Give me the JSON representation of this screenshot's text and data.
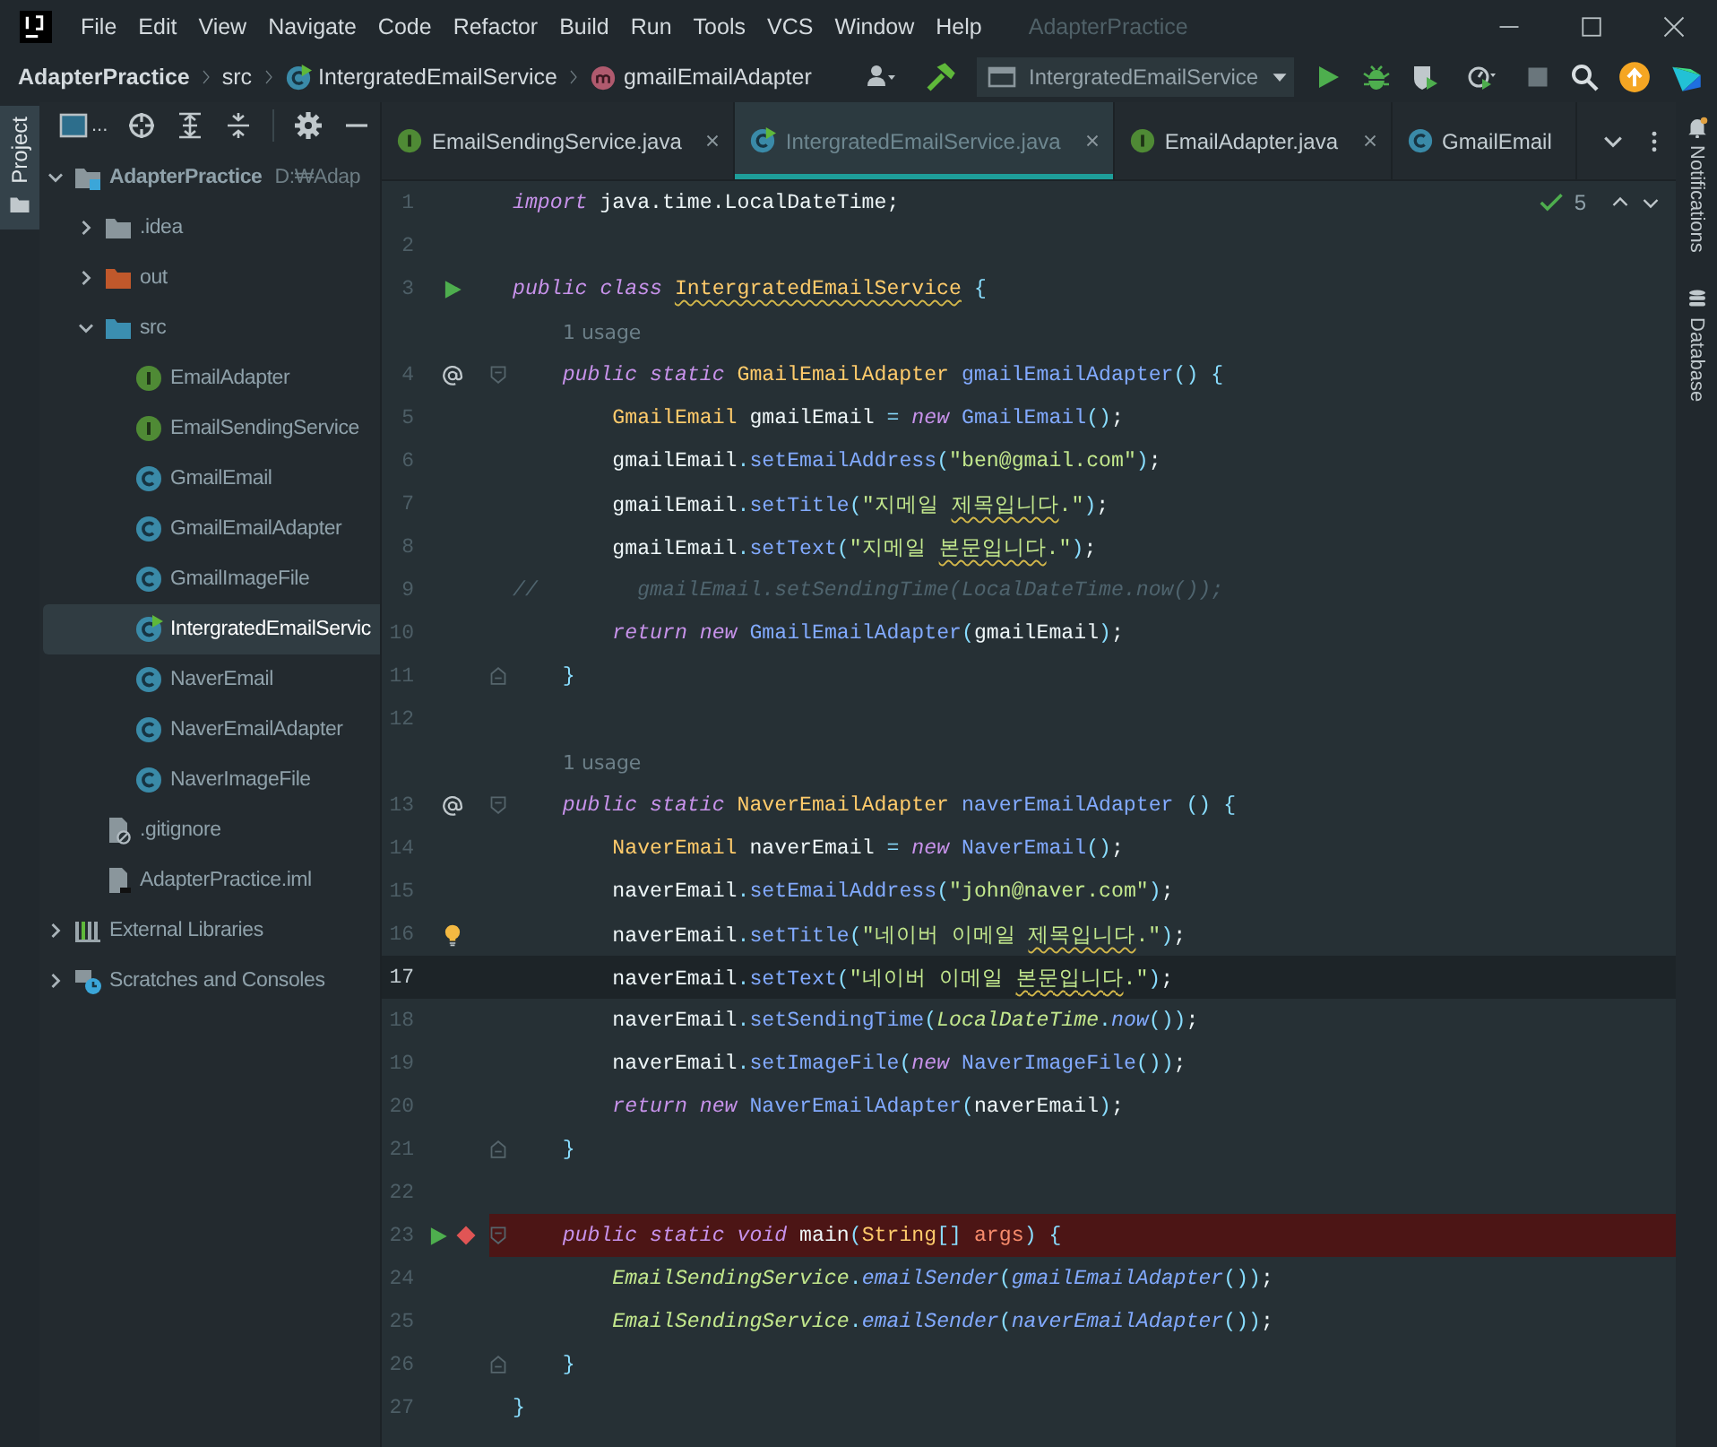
{
  "window": {
    "title": "AdapterPractice"
  },
  "menu": [
    "File",
    "Edit",
    "View",
    "Navigate",
    "Code",
    "Refactor",
    "Build",
    "Run",
    "Tools",
    "VCS",
    "Window",
    "Help"
  ],
  "breadcrumbs": [
    {
      "label": "AdapterPractice",
      "kind": "project"
    },
    {
      "label": "src",
      "kind": "folder"
    },
    {
      "label": "IntergratedEmailService",
      "kind": "main-class"
    },
    {
      "label": "gmailEmailAdapter",
      "kind": "method"
    }
  ],
  "toolbar": {
    "run_config": "IntergratedEmailService"
  },
  "project_panel": {
    "tab": "Project",
    "view_selector": "...",
    "tree": [
      {
        "label": "AdapterPractice",
        "path": "D:₩Adap",
        "kind": "module",
        "expanded": true,
        "selected": false,
        "children": [
          {
            "label": ".idea",
            "kind": "folder",
            "expanded": false,
            "selected": false
          },
          {
            "label": "out",
            "kind": "excluded-folder",
            "expanded": false,
            "selected": false
          },
          {
            "label": "src",
            "kind": "source-folder",
            "expanded": true,
            "selected": false,
            "children": [
              {
                "label": "EmailAdapter",
                "kind": "interface",
                "selected": false
              },
              {
                "label": "EmailSendingService",
                "kind": "interface",
                "selected": false
              },
              {
                "label": "GmailEmail",
                "kind": "class",
                "selected": false
              },
              {
                "label": "GmailEmailAdapter",
                "kind": "class",
                "selected": false
              },
              {
                "label": "GmailImageFile",
                "kind": "class",
                "selected": false
              },
              {
                "label": "IntergratedEmailServic",
                "kind": "main-class",
                "selected": true
              },
              {
                "label": "NaverEmail",
                "kind": "class",
                "selected": false
              },
              {
                "label": "NaverEmailAdapter",
                "kind": "class",
                "selected": false
              },
              {
                "label": "NaverImageFile",
                "kind": "class",
                "selected": false
              }
            ]
          },
          {
            "label": ".gitignore",
            "kind": "ignore-file",
            "selected": false
          },
          {
            "label": "AdapterPractice.iml",
            "kind": "module-file",
            "selected": false
          }
        ]
      },
      {
        "label": "External Libraries",
        "kind": "libraries",
        "expanded": false,
        "selected": false
      },
      {
        "label": "Scratches and Consoles",
        "kind": "scratches",
        "expanded": false,
        "selected": false
      }
    ]
  },
  "tabs": [
    {
      "label": "EmailSendingService.java",
      "kind": "interface",
      "selected": false,
      "closable": true
    },
    {
      "label": "IntergratedEmailService.java",
      "kind": "main-class",
      "selected": true,
      "closable": true
    },
    {
      "label": "EmailAdapter.java",
      "kind": "interface",
      "selected": false,
      "closable": true
    },
    {
      "label": "GmailEmail",
      "kind": "class",
      "selected": false,
      "closable": false
    }
  ],
  "inspections": {
    "count": "5"
  },
  "editor": {
    "lines": [
      {
        "number": "1",
        "current": false,
        "breakpoint": false,
        "tokens": [
          {
            "kind": "kw",
            "text": "import "
          },
          {
            "kind": "id",
            "text": "java.time.LocalDateTime;"
          }
        ]
      },
      {
        "number": "2",
        "current": false,
        "breakpoint": false
      },
      {
        "number": "3",
        "current": false,
        "breakpoint": false,
        "gutter": {
          "kind": "run"
        },
        "tokens": [
          {
            "kind": "kw",
            "text": "public class "
          },
          {
            "kind": "type",
            "text": "IntergratedEmailService",
            "warn": true
          },
          {
            "kind": "punc",
            "text": " {"
          }
        ]
      },
      {
        "kind": "hint",
        "text": "1 usage"
      },
      {
        "number": "4",
        "current": false,
        "breakpoint": false,
        "gutter": {
          "kind": "at"
        },
        "fold": {
          "kind": "start"
        },
        "tokens": [
          {
            "kind": "kw",
            "text": "    public static "
          },
          {
            "kind": "type",
            "text": "GmailEmailAdapter "
          },
          {
            "kind": "fn",
            "text": "gmailEmailAdapter"
          },
          {
            "kind": "punc",
            "text": "() {"
          }
        ]
      },
      {
        "number": "5",
        "current": false,
        "breakpoint": false,
        "tokens": [
          {
            "kind": "type",
            "text": "        GmailEmail "
          },
          {
            "kind": "id",
            "text": "gmailEmail "
          },
          {
            "kind": "punc",
            "text": "= "
          },
          {
            "kind": "kw",
            "text": "new "
          },
          {
            "kind": "fn",
            "text": "GmailEmail"
          },
          {
            "kind": "punc",
            "text": "()"
          },
          {
            "kind": "id",
            "text": ";"
          }
        ]
      },
      {
        "number": "6",
        "current": false,
        "breakpoint": false,
        "tokens": [
          {
            "kind": "id",
            "text": "        gmailEmail"
          },
          {
            "kind": "punc",
            "text": "."
          },
          {
            "kind": "fn",
            "text": "setEmailAddress"
          },
          {
            "kind": "punc",
            "text": "("
          },
          {
            "kind": "str",
            "text": "\"ben@gmail.com\""
          },
          {
            "kind": "punc",
            "text": ")"
          },
          {
            "kind": "id",
            "text": ";"
          }
        ]
      },
      {
        "number": "7",
        "current": false,
        "breakpoint": false,
        "tokens": [
          {
            "kind": "id",
            "text": "        gmailEmail"
          },
          {
            "kind": "punc",
            "text": "."
          },
          {
            "kind": "fn",
            "text": "setTitle"
          },
          {
            "kind": "punc",
            "text": "("
          },
          {
            "kind": "str",
            "text": "\"지메일 "
          },
          {
            "kind": "str",
            "text": "제목입니다",
            "warn": true
          },
          {
            "kind": "str",
            "text": ".\""
          },
          {
            "kind": "punc",
            "text": ")"
          },
          {
            "kind": "id",
            "text": ";"
          }
        ]
      },
      {
        "number": "8",
        "current": false,
        "breakpoint": false,
        "tokens": [
          {
            "kind": "id",
            "text": "        gmailEmail"
          },
          {
            "kind": "punc",
            "text": "."
          },
          {
            "kind": "fn",
            "text": "setText"
          },
          {
            "kind": "punc",
            "text": "("
          },
          {
            "kind": "str",
            "text": "\"지메일 "
          },
          {
            "kind": "str",
            "text": "본문입니다",
            "warn": true
          },
          {
            "kind": "str",
            "text": ".\""
          },
          {
            "kind": "punc",
            "text": ")"
          },
          {
            "kind": "id",
            "text": ";"
          }
        ]
      },
      {
        "number": "9",
        "current": false,
        "breakpoint": false,
        "tokens": [
          {
            "kind": "comment",
            "text": "//        gmailEmail.setSendingTime(LocalDateTime.now());"
          }
        ]
      },
      {
        "number": "10",
        "current": false,
        "breakpoint": false,
        "tokens": [
          {
            "kind": "kw",
            "text": "        return new "
          },
          {
            "kind": "fn",
            "text": "GmailEmailAdapter"
          },
          {
            "kind": "punc",
            "text": "("
          },
          {
            "kind": "id",
            "text": "gmailEmail"
          },
          {
            "kind": "punc",
            "text": ")"
          },
          {
            "kind": "id",
            "text": ";"
          }
        ]
      },
      {
        "number": "11",
        "current": false,
        "breakpoint": false,
        "fold": {
          "kind": "end"
        },
        "tokens": [
          {
            "kind": "punc",
            "text": "    }"
          }
        ]
      },
      {
        "number": "12",
        "current": false,
        "breakpoint": false
      },
      {
        "kind": "hint",
        "text": "1 usage"
      },
      {
        "number": "13",
        "current": false,
        "breakpoint": false,
        "gutter": {
          "kind": "at"
        },
        "fold": {
          "kind": "start"
        },
        "tokens": [
          {
            "kind": "kw",
            "text": "    public static "
          },
          {
            "kind": "type",
            "text": "NaverEmailAdapter "
          },
          {
            "kind": "fn",
            "text": "naverEmailAdapter "
          },
          {
            "kind": "punc",
            "text": "() {"
          }
        ]
      },
      {
        "number": "14",
        "current": false,
        "breakpoint": false,
        "tokens": [
          {
            "kind": "type",
            "text": "        NaverEmail "
          },
          {
            "kind": "id",
            "text": "naverEmail "
          },
          {
            "kind": "punc",
            "text": "= "
          },
          {
            "kind": "kw",
            "text": "new "
          },
          {
            "kind": "fn",
            "text": "NaverEmail"
          },
          {
            "kind": "punc",
            "text": "()"
          },
          {
            "kind": "id",
            "text": ";"
          }
        ]
      },
      {
        "number": "15",
        "current": false,
        "breakpoint": false,
        "tokens": [
          {
            "kind": "id",
            "text": "        naverEmail"
          },
          {
            "kind": "punc",
            "text": "."
          },
          {
            "kind": "fn",
            "text": "setEmailAddress"
          },
          {
            "kind": "punc",
            "text": "("
          },
          {
            "kind": "str",
            "text": "\"john@naver.com\""
          },
          {
            "kind": "punc",
            "text": ")"
          },
          {
            "kind": "id",
            "text": ";"
          }
        ]
      },
      {
        "number": "16",
        "current": false,
        "breakpoint": false,
        "gutter": {
          "kind": "bulb"
        },
        "tokens": [
          {
            "kind": "id",
            "text": "        naverEmail"
          },
          {
            "kind": "punc",
            "text": "."
          },
          {
            "kind": "fn",
            "text": "setTitle"
          },
          {
            "kind": "punc",
            "text": "("
          },
          {
            "kind": "str",
            "text": "\"네이버 이메일 "
          },
          {
            "kind": "str",
            "text": "제목입니다",
            "warn": true
          },
          {
            "kind": "str",
            "text": ".\""
          },
          {
            "kind": "punc",
            "text": ")"
          },
          {
            "kind": "id",
            "text": ";"
          }
        ]
      },
      {
        "number": "17",
        "current": true,
        "breakpoint": false,
        "tokens": [
          {
            "kind": "id",
            "text": "        naverEmail"
          },
          {
            "kind": "punc",
            "text": "."
          },
          {
            "kind": "fn",
            "text": "setText"
          },
          {
            "kind": "punc",
            "text": "("
          },
          {
            "kind": "str",
            "text": "\"네이버 이메일 "
          },
          {
            "kind": "str",
            "text": "본문입니다",
            "warn": true
          },
          {
            "kind": "str",
            "text": ".\""
          },
          {
            "kind": "punc",
            "text": ")"
          },
          {
            "kind": "id",
            "text": ";"
          }
        ]
      },
      {
        "number": "18",
        "current": false,
        "breakpoint": false,
        "tokens": [
          {
            "kind": "id",
            "text": "        naverEmail"
          },
          {
            "kind": "punc",
            "text": "."
          },
          {
            "kind": "fn",
            "text": "setSendingTime"
          },
          {
            "kind": "punc",
            "text": "("
          },
          {
            "kind": "stype",
            "text": "LocalDateTime"
          },
          {
            "kind": "punc",
            "text": "."
          },
          {
            "kind": "sfn",
            "text": "now"
          },
          {
            "kind": "punc",
            "text": "())"
          },
          {
            "kind": "id",
            "text": ";"
          }
        ]
      },
      {
        "number": "19",
        "current": false,
        "breakpoint": false,
        "tokens": [
          {
            "kind": "id",
            "text": "        naverEmail"
          },
          {
            "kind": "punc",
            "text": "."
          },
          {
            "kind": "fn",
            "text": "setImageFile"
          },
          {
            "kind": "punc",
            "text": "("
          },
          {
            "kind": "kw",
            "text": "new "
          },
          {
            "kind": "fn",
            "text": "NaverImageFile"
          },
          {
            "kind": "punc",
            "text": "())"
          },
          {
            "kind": "id",
            "text": ";"
          }
        ]
      },
      {
        "number": "20",
        "current": false,
        "breakpoint": false,
        "tokens": [
          {
            "kind": "kw",
            "text": "        return new "
          },
          {
            "kind": "fn",
            "text": "NaverEmailAdapter"
          },
          {
            "kind": "punc",
            "text": "("
          },
          {
            "kind": "id",
            "text": "naverEmail"
          },
          {
            "kind": "punc",
            "text": ")"
          },
          {
            "kind": "id",
            "text": ";"
          }
        ]
      },
      {
        "number": "21",
        "current": false,
        "breakpoint": false,
        "fold": {
          "kind": "end"
        },
        "tokens": [
          {
            "kind": "punc",
            "text": "    }"
          }
        ]
      },
      {
        "number": "22",
        "current": false,
        "breakpoint": false
      },
      {
        "number": "23",
        "current": false,
        "breakpoint": true,
        "gutter": {
          "kind": "run"
        },
        "fold": {
          "kind": "start"
        },
        "tokens": [
          {
            "kind": "kw",
            "text": "    public static void "
          },
          {
            "kind": "id",
            "text": "main"
          },
          {
            "kind": "punc",
            "text": "("
          },
          {
            "kind": "type",
            "text": "String"
          },
          {
            "kind": "punc",
            "text": "[] "
          },
          {
            "kind": "param",
            "text": "args"
          },
          {
            "kind": "punc",
            "text": ") {"
          }
        ]
      },
      {
        "number": "24",
        "current": false,
        "breakpoint": false,
        "tokens": [
          {
            "kind": "stype",
            "text": "        EmailSendingService"
          },
          {
            "kind": "punc",
            "text": "."
          },
          {
            "kind": "sfn",
            "text": "emailSender"
          },
          {
            "kind": "punc",
            "text": "("
          },
          {
            "kind": "sfn",
            "text": "gmailEmailAdapter"
          },
          {
            "kind": "punc",
            "text": "())"
          },
          {
            "kind": "id",
            "text": ";"
          }
        ]
      },
      {
        "number": "25",
        "current": false,
        "breakpoint": false,
        "tokens": [
          {
            "kind": "stype",
            "text": "        EmailSendingService"
          },
          {
            "kind": "punc",
            "text": "."
          },
          {
            "kind": "sfn",
            "text": "emailSender"
          },
          {
            "kind": "punc",
            "text": "("
          },
          {
            "kind": "sfn",
            "text": "naverEmailAdapter"
          },
          {
            "kind": "punc",
            "text": "())"
          },
          {
            "kind": "id",
            "text": ";"
          }
        ]
      },
      {
        "number": "26",
        "current": false,
        "breakpoint": false,
        "fold": {
          "kind": "end"
        },
        "tokens": [
          {
            "kind": "punc",
            "text": "    }"
          }
        ]
      },
      {
        "number": "27",
        "current": false,
        "breakpoint": false,
        "tokens": [
          {
            "kind": "punc",
            "text": "}"
          }
        ]
      }
    ]
  },
  "right_strip": [
    "Notifications",
    "Database"
  ]
}
